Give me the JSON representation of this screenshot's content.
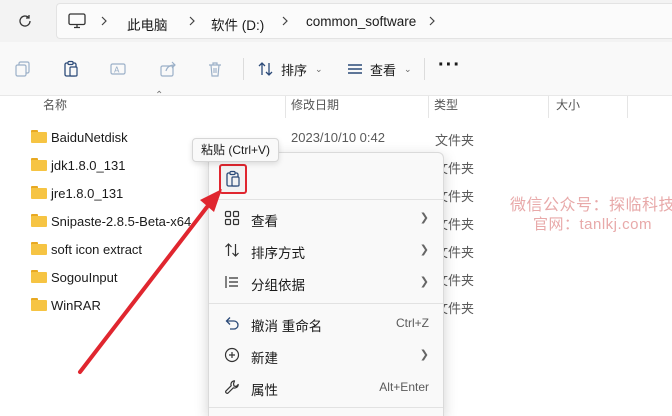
{
  "address": {
    "refresh_icon": "refresh-icon",
    "pc_icon": "monitor-icon",
    "crumbs": [
      "此电脑",
      "软件 (D:)",
      "common_software"
    ]
  },
  "toolbar": {
    "sort_label": "排序",
    "view_label": "查看",
    "more_label": "···"
  },
  "columns": {
    "name": "名称",
    "date": "修改日期",
    "type": "类型",
    "size": "大小"
  },
  "files": [
    {
      "name": "BaiduNetdisk",
      "date": "2023/10/10 0:42",
      "type": "文件夹"
    },
    {
      "name": "jdk1.8.0_131",
      "date": "",
      "type": "文件夹"
    },
    {
      "name": "jre1.8.0_131",
      "date": "",
      "type": "文件夹"
    },
    {
      "name": "Snipaste-2.8.5-Beta-x64",
      "date": "",
      "type": "文件夹"
    },
    {
      "name": "soft icon extract",
      "date": "",
      "type": "文件夹"
    },
    {
      "name": "SogouInput",
      "date": "",
      "type": "文件夹"
    },
    {
      "name": "WinRAR",
      "date": "",
      "type": "文件夹"
    }
  ],
  "tooltip": "粘贴 (Ctrl+V)",
  "context_menu": {
    "items": [
      {
        "label": "查看",
        "icon": "grid-icon",
        "submenu": true
      },
      {
        "label": "排序方式",
        "icon": "sort-icon",
        "submenu": true
      },
      {
        "label": "分组依据",
        "icon": "group-icon",
        "submenu": true
      },
      {
        "label": "撤消 重命名",
        "icon": "undo-icon",
        "shortcut": "Ctrl+Z"
      },
      {
        "label": "新建",
        "icon": "new-icon",
        "submenu": true
      },
      {
        "label": "属性",
        "icon": "wrench-icon",
        "shortcut": "Alt+Enter"
      }
    ]
  },
  "watermark": {
    "line1": "微信公众号：探临科技",
    "line2": "官网：tanlkj.com"
  },
  "colors": {
    "accent_red": "#e0262f",
    "folder": "#f6c443",
    "watermark": "#e8a9a9"
  }
}
